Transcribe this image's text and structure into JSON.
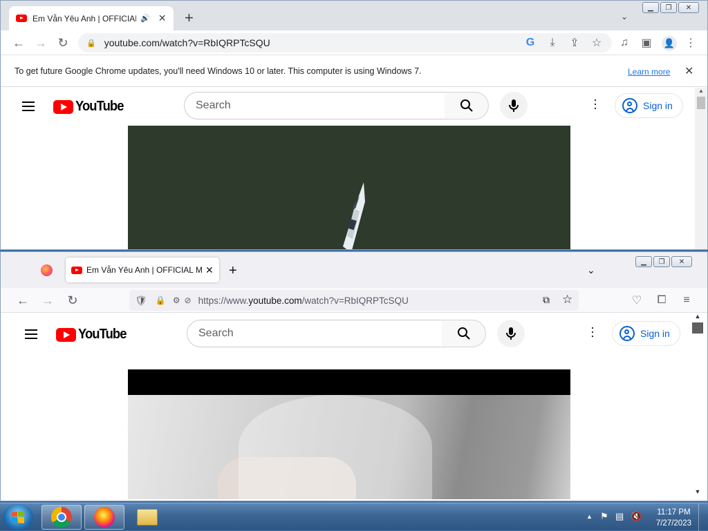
{
  "chrome": {
    "tab_title": "Em Vẫn Yêu Anh | OFFICIAL MUSIC VIDEO",
    "new_tab_label": "+",
    "url": "youtube.com/watch?v=RbIQRPTcSQU",
    "infobar_text": "To get future Google Chrome updates, you'll need Windows 10 or later. This computer is using Windows 7.",
    "infobar_link": "Learn more"
  },
  "youtube_top": {
    "logo_text": "YouTube",
    "search_placeholder": "Search",
    "signin_label": "Sign in"
  },
  "firefox": {
    "tab_title": "Em Vẫn Yêu Anh | OFFICIAL MUSIC VIDEO",
    "new_tab_label": "+",
    "url_prefix": "https://www.",
    "url_domain": "youtube.com",
    "url_path": "/watch?v=RbIQRPTcSQU"
  },
  "youtube_bottom": {
    "logo_text": "YouTube",
    "search_placeholder": "Search",
    "signin_label": "Sign in"
  },
  "taskbar": {
    "time": "11:17 PM",
    "date": "7/27/2023"
  },
  "colors": {
    "youtube_red": "#ff0000",
    "link_blue": "#065fd4",
    "taskbar": "#3c6593"
  }
}
